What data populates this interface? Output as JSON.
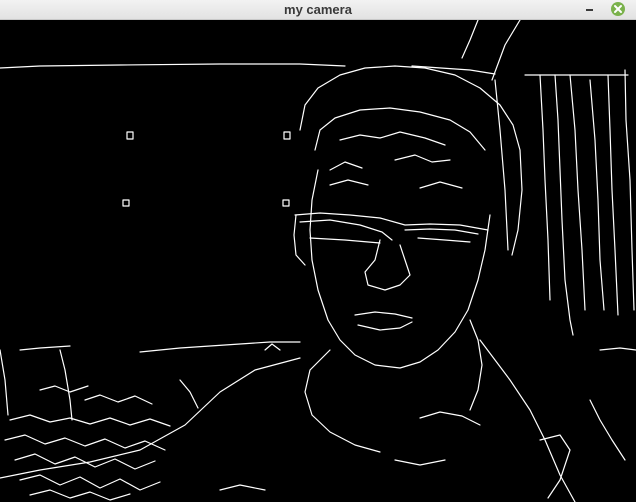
{
  "window": {
    "title": "my camera",
    "controls": {
      "minimize_icon": "minimize-icon",
      "close_icon": "close-icon",
      "close_color": "#7bb24c"
    }
  },
  "viewport": {
    "background": "#000000",
    "edge_color": "#ffffff",
    "content_description_icon": "edge-detection-feed"
  }
}
